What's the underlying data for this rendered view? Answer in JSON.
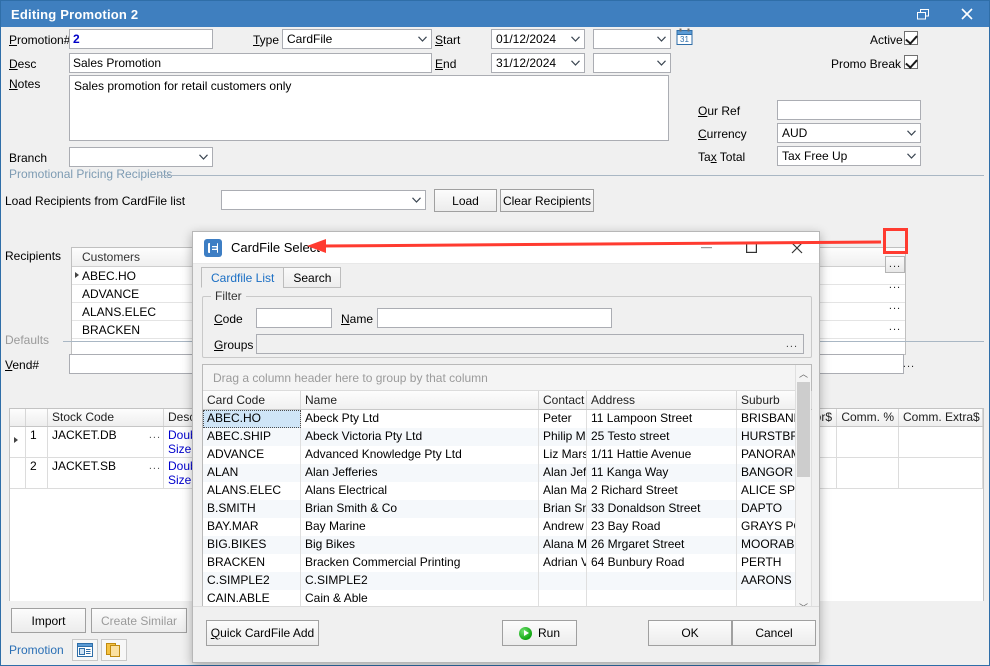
{
  "window": {
    "title": "Editing Promotion 2",
    "controls": {
      "restore": "restore-icon",
      "close": "close-icon"
    }
  },
  "form": {
    "promotion_number": {
      "label": "Promotion#",
      "value": "2"
    },
    "type": {
      "label": "Type",
      "value": "CardFile"
    },
    "start": {
      "label": "Start",
      "value": "01/12/2024",
      "extra_value": ""
    },
    "end": {
      "label": "End",
      "value": "31/12/2024",
      "extra_value": ""
    },
    "calendar_icon": "calendar-icon",
    "active": {
      "label": "Active",
      "checked": true
    },
    "promo_break": {
      "label": "Promo Break",
      "checked": true
    },
    "desc": {
      "label": "Desc",
      "value": "Sales Promotion"
    },
    "notes": {
      "label": "Notes",
      "value": "Sales promotion for retail customers only"
    },
    "our_ref": {
      "label": "Our Ref",
      "value": ""
    },
    "currency": {
      "label": "Currency",
      "value": "AUD"
    },
    "tax_total": {
      "label": "Tax Total",
      "value": "Tax Free Up"
    },
    "branch": {
      "label": "Branch",
      "value": ""
    }
  },
  "recipients_group": {
    "title": "Promotional Pricing Recipients",
    "load_label": "Load Recipients from CardFile list",
    "load_combo_value": "",
    "load_button": "Load",
    "clear_button": "Clear Recipients",
    "recipients_label": "Recipients",
    "column_header": "Customers",
    "rows": [
      "ABEC.HO",
      "ADVANCE",
      "ALANS.ELEC",
      "BRACKEN"
    ],
    "ellipsis_label": "..."
  },
  "defaults_group": {
    "title": "Defaults",
    "vend_label": "Vend#",
    "vend_value": ""
  },
  "stock_grid": {
    "columns": [
      "",
      "",
      "Stock Code",
      "Descrip",
      "",
      "loor$",
      "Comm. %",
      "Comm. Extra$"
    ],
    "rows": [
      {
        "num": "1",
        "stock_code": "JACKET.DB",
        "desc_line1": "Double",
        "desc_line2": "Size:M",
        "floor": "",
        "comm_pct": "",
        "comm_extra": "",
        "selected": true
      },
      {
        "num": "2",
        "stock_code": "JACKET.SB",
        "desc_line1": "Double",
        "desc_line2": "Size:M",
        "floor": "",
        "comm_pct": "",
        "comm_extra": "",
        "selected": false
      }
    ],
    "ellipsis_label": "..."
  },
  "bottom_bar": {
    "import_button": "Import",
    "create_similar_button": "Create Similar",
    "tab_label": "Promotion",
    "icon1": "form-view-icon",
    "icon2": "copy-pages-icon"
  },
  "dialog": {
    "title": "CardFile Select",
    "icon": "cardfile-icon",
    "minimize": "minimize-icon",
    "maximize": "maximize-icon",
    "close": "close-icon",
    "tabs": [
      {
        "label": "Cardfile List",
        "active": true
      },
      {
        "label": "Search",
        "active": false
      }
    ],
    "filter": {
      "legend": "Filter",
      "code_label": "Code",
      "code_value": "",
      "name_label": "Name",
      "name_value": "",
      "groups_label": "Groups",
      "groups_value": "",
      "groups_ellipsis": "..."
    },
    "group_hint": "Drag a column header here to group by that column",
    "grid": {
      "columns": [
        "Card Code",
        "Name",
        "Contact",
        "Address",
        "Suburb"
      ],
      "rows": [
        {
          "code": "ABEC.HO",
          "name": "Abeck Pty Ltd",
          "contact": "Peter",
          "address": "11 Lampoon Street",
          "suburb": "BRISBANE",
          "selected": true
        },
        {
          "code": "ABEC.SHIP",
          "name": "Abeck Victoria Pty Ltd",
          "contact": "Philip Mc",
          "address": "25 Testo street",
          "suburb": "HURSTBRI",
          "selected": false
        },
        {
          "code": "ADVANCE",
          "name": "Advanced Knowledge Pty Ltd",
          "contact": "Liz Marsl",
          "address": "1/11 Hattie Avenue",
          "suburb": "PANORAM",
          "selected": false
        },
        {
          "code": "ALAN",
          "name": "Alan Jefferies",
          "contact": "Alan Jef",
          "address": "11 Kanga Way",
          "suburb": "BANGOR",
          "selected": false
        },
        {
          "code": "ALANS.ELEC",
          "name": "Alans Electrical",
          "contact": "Alan Mar",
          "address": "2 Richard Street",
          "suburb": "ALICE SPR",
          "selected": false
        },
        {
          "code": "B.SMITH",
          "name": "Brian Smith & Co",
          "contact": "Brian Sm",
          "address": "33 Donaldson Street",
          "suburb": "DAPTO",
          "selected": false
        },
        {
          "code": "BAY.MAR",
          "name": "Bay Marine",
          "contact": "Andrew",
          "address": "23 Bay Road",
          "suburb": "GRAYS PO",
          "selected": false
        },
        {
          "code": "BIG.BIKES",
          "name": "Big Bikes",
          "contact": "Alana M",
          "address": "26 Mrgaret Street",
          "suburb": "MOORABB",
          "selected": false
        },
        {
          "code": "BRACKEN",
          "name": "Bracken Commercial Printing",
          "contact": "Adrian V",
          "address": "64 Bunbury Road",
          "suburb": "PERTH",
          "selected": false
        },
        {
          "code": "C.SIMPLE2",
          "name": "C.SIMPLE2",
          "contact": "",
          "address": "",
          "suburb": "AARONS P",
          "selected": false
        },
        {
          "code": "CAIN.ABLE",
          "name": "Cain & Able",
          "contact": "",
          "address": "",
          "suburb": "",
          "selected": false
        }
      ]
    },
    "footer": {
      "quick_add": "Quick CardFile Add",
      "run": "Run",
      "ok": "OK",
      "cancel": "Cancel",
      "run_icon": "run-play-icon"
    }
  },
  "annotation": {
    "arrow_color": "#ff3b30",
    "highlight_color": "#ff3b30",
    "points_to": "recipients-ellipsis-button"
  }
}
